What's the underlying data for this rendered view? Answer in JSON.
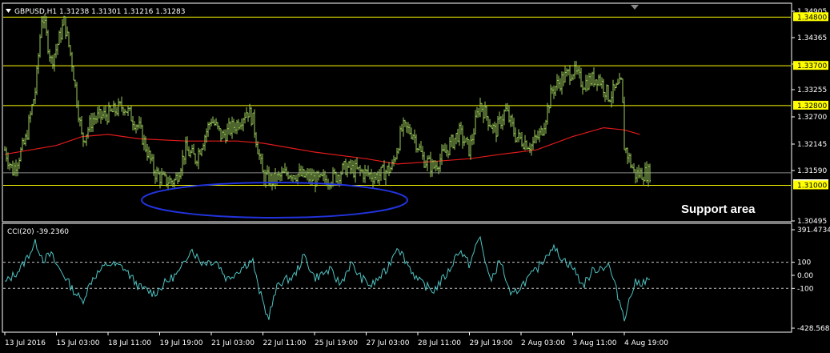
{
  "title": "GBPUSD,H1  1.31238 1.31301 1.31216 1.31283",
  "annotation": "Support area",
  "colors": {
    "background": "#000000",
    "price": "#9ccc5a",
    "ma": "#e11a1a",
    "hline": "#ffff00",
    "cci": "#4fc3c3",
    "ellipse": "#2233dd",
    "frame": "#ffffff",
    "dotted": "#c8c8c8"
  },
  "price_axis_ticks": [
    "1.34905",
    "1.34365",
    "1.33810",
    "1.33255",
    "1.32700",
    "1.32145",
    "1.31590",
    "1.31283",
    "1.30495"
  ],
  "price_levels": [
    "1.34800",
    "1.33700",
    "1.32800",
    "1.31000"
  ],
  "current_price": "1.31283",
  "cci_label": "CCI(20) -39.2360",
  "cci_axis_ticks": [
    "391.4734",
    "100",
    "0.00",
    "-100",
    "-428.5683"
  ],
  "x_labels": [
    "13 Jul 2016",
    "15 Jul 03:00",
    "18 Jul 11:00",
    "19 Jul 19:00",
    "21 Jul 03:00",
    "22 Jul 11:00",
    "25 Jul 19:00",
    "27 Jul 03:00",
    "28 Jul 11:00",
    "29 Jul 19:00",
    "2 Aug 03:00",
    "3 Aug 11:00",
    "4 Aug 19:00"
  ],
  "chart_data": [
    {
      "type": "line",
      "title": "GBPUSD,H1",
      "ylim": [
        1.30195,
        1.35095
      ],
      "x_positions": [
        "13 Jul 2016",
        "15 Jul 03:00",
        "18 Jul 11:00",
        "19 Jul 19:00",
        "21 Jul 03:00",
        "22 Jul 11:00",
        "25 Jul 19:00",
        "27 Jul 03:00",
        "28 Jul 11:00",
        "29 Jul 19:00",
        "2 Aug 03:00",
        "3 Aug 11:00",
        "4 Aug 19:00"
      ],
      "price_path": [
        [
          0,
          1.318
        ],
        [
          0.15,
          1.3132
        ],
        [
          0.4,
          1.32
        ],
        [
          0.6,
          1.332
        ],
        [
          0.72,
          1.349
        ],
        [
          0.9,
          1.338
        ],
        [
          1,
          1.341
        ],
        [
          1.15,
          1.347
        ],
        [
          1.3,
          1.338
        ],
        [
          1.5,
          1.32
        ],
        [
          1.7,
          1.325
        ],
        [
          2.0,
          1.326
        ],
        [
          2.3,
          1.328
        ],
        [
          2.6,
          1.323
        ],
        [
          2.9,
          1.313
        ],
        [
          3.1,
          1.311
        ],
        [
          3.3,
          1.311
        ],
        [
          3.5,
          1.318
        ],
        [
          3.7,
          1.316
        ],
        [
          4.0,
          1.325
        ],
        [
          4.2,
          1.321
        ],
        [
          4.5,
          1.324
        ],
        [
          4.7,
          1.327
        ],
        [
          4.8,
          1.325
        ],
        [
          5.0,
          1.312
        ],
        [
          5.2,
          1.311
        ],
        [
          5.5,
          1.313
        ],
        [
          5.8,
          1.312
        ],
        [
          6.1,
          1.311
        ],
        [
          6.4,
          1.312
        ],
        [
          6.6,
          1.314
        ],
        [
          6.9,
          1.313
        ],
        [
          7.2,
          1.312
        ],
        [
          7.5,
          1.314
        ],
        [
          7.7,
          1.323
        ],
        [
          7.9,
          1.322
        ],
        [
          8.1,
          1.316
        ],
        [
          8.3,
          1.314
        ],
        [
          8.5,
          1.317
        ],
        [
          8.8,
          1.322
        ],
        [
          9.0,
          1.318
        ],
        [
          9.2,
          1.3285
        ],
        [
          9.5,
          1.322
        ],
        [
          9.7,
          1.327
        ],
        [
          9.9,
          1.321
        ],
        [
          10.2,
          1.319
        ],
        [
          10.4,
          1.322
        ],
        [
          10.6,
          1.3315
        ],
        [
          10.8,
          1.334
        ],
        [
          11.0,
          1.336
        ],
        [
          11.2,
          1.333
        ],
        [
          11.5,
          1.3345
        ],
        [
          11.7,
          1.33
        ],
        [
          11.95,
          1.333
        ],
        [
          12.0,
          1.319
        ],
        [
          12.2,
          1.3125
        ],
        [
          12.5,
          1.3128
        ]
      ],
      "ma_path": [
        [
          0,
          1.317
        ],
        [
          1,
          1.319
        ],
        [
          1.5,
          1.321
        ],
        [
          2,
          1.3215
        ],
        [
          2.6,
          1.3205
        ],
        [
          3.5,
          1.32
        ],
        [
          4.5,
          1.32
        ],
        [
          5,
          1.3195
        ],
        [
          6,
          1.3175
        ],
        [
          7,
          1.316
        ],
        [
          7.6,
          1.3148
        ],
        [
          8.1,
          1.3152
        ],
        [
          9,
          1.316
        ],
        [
          9.6,
          1.317
        ],
        [
          10.3,
          1.318
        ],
        [
          11,
          1.321
        ],
        [
          11.6,
          1.323
        ],
        [
          12.0,
          1.3225
        ],
        [
          12.3,
          1.3215
        ]
      ],
      "horizontal_lines": [
        1.348,
        1.337,
        1.328,
        1.31
      ],
      "current": 1.31283
    },
    {
      "type": "line",
      "title": "CCI(20)",
      "ylim": [
        -428.5683,
        391.4734
      ],
      "levels": [
        100,
        -100
      ],
      "cci_path": [
        [
          0,
          -60
        ],
        [
          0.3,
          50
        ],
        [
          0.6,
          250
        ],
        [
          0.75,
          120
        ],
        [
          0.9,
          160
        ],
        [
          1.0,
          80
        ],
        [
          1.15,
          0
        ],
        [
          1.3,
          -100
        ],
        [
          1.5,
          -200
        ],
        [
          1.7,
          -20
        ],
        [
          2.0,
          90
        ],
        [
          2.3,
          60
        ],
        [
          2.6,
          -90
        ],
        [
          2.9,
          -140
        ],
        [
          3.1,
          -60
        ],
        [
          3.4,
          30
        ],
        [
          3.6,
          210
        ],
        [
          3.8,
          100
        ],
        [
          4.1,
          110
        ],
        [
          4.3,
          -30
        ],
        [
          4.6,
          60
        ],
        [
          4.8,
          120
        ],
        [
          4.9,
          -80
        ],
        [
          5.1,
          -330
        ],
        [
          5.3,
          -60
        ],
        [
          5.6,
          -10
        ],
        [
          5.8,
          150
        ],
        [
          6.0,
          -20
        ],
        [
          6.3,
          40
        ],
        [
          6.5,
          -70
        ],
        [
          6.7,
          90
        ],
        [
          6.9,
          -20
        ],
        [
          7.1,
          -80
        ],
        [
          7.4,
          40
        ],
        [
          7.6,
          230
        ],
        [
          7.8,
          90
        ],
        [
          8.0,
          -40
        ],
        [
          8.3,
          -120
        ],
        [
          8.6,
          30
        ],
        [
          8.8,
          200
        ],
        [
          9.0,
          80
        ],
        [
          9.2,
          300
        ],
        [
          9.4,
          -50
        ],
        [
          9.6,
          120
        ],
        [
          9.8,
          -170
        ],
        [
          10.0,
          -80
        ],
        [
          10.3,
          40
        ],
        [
          10.6,
          220
        ],
        [
          10.8,
          130
        ],
        [
          11.0,
          60
        ],
        [
          11.2,
          -80
        ],
        [
          11.4,
          40
        ],
        [
          11.7,
          80
        ],
        [
          11.85,
          -120
        ],
        [
          12.0,
          -320
        ],
        [
          12.2,
          -60
        ],
        [
          12.5,
          -40
        ]
      ]
    }
  ]
}
